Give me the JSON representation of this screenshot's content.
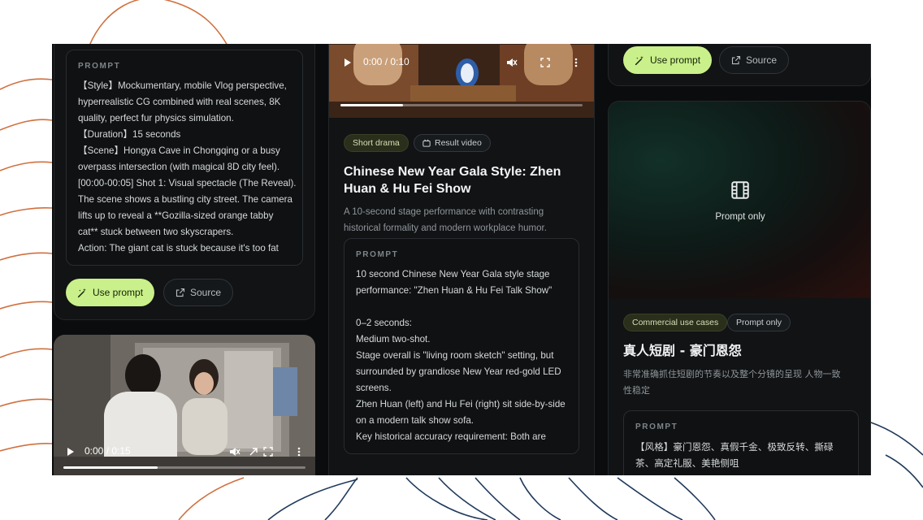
{
  "prompt_label": "PROMPT",
  "left_card": {
    "prompt_lines": [
      "【Style】Mockumentary, mobile Vlog perspective,",
      "hyperrealistic CG combined with real scenes, 8K",
      "quality, perfect fur physics simulation.",
      "【Duration】15 seconds",
      "【Scene】Hongya Cave in Chongqing or a busy",
      "overpass intersection (with magical 8D city feel).",
      "[00:00-00:05] Shot 1: Visual spectacle (The Reveal).",
      "The scene shows a bustling city street. The camera",
      "lifts up to reveal a **Gozilla-sized orange tabby",
      "cat** stuck between two skyscrapers.",
      "Action: The giant cat is stuck because it's too fat"
    ],
    "use_prompt": "Use prompt",
    "source": "Source"
  },
  "left_video": {
    "time": "0:00 / 0:15",
    "progress": 0.39
  },
  "middle_card": {
    "video": {
      "time": "0:00 / 0:10",
      "progress": 0.26
    },
    "tag1": "Short drama",
    "tag2": "Result video",
    "title_line1": "Chinese New Year Gala Style: Zhen",
    "title_line2": "Huan & Hu Fei Show",
    "desc_line1": "A 10-second stage performance with contrasting",
    "desc_line2": "historical formality and modern workplace humor.",
    "prompt_lines": [
      "10 second Chinese New Year Gala style stage",
      "performance: \"Zhen Huan & Hu Fei Talk Show\"",
      "",
      "0–2 seconds:",
      "Medium two-shot.",
      "Stage overall is \"living room sketch\" setting, but",
      "surrounded by grandiose New Year red-gold LED",
      "screens.",
      "Zhen Huan (left) and Hu Fei (right) sit side-by-side",
      "on a modern talk show sofa.",
      " Key historical accuracy requirement: Both are"
    ]
  },
  "right_top": {
    "use_prompt": "Use prompt",
    "source": "Source"
  },
  "right_card": {
    "placeholder": "Prompt only",
    "tag1": "Commercial use cases",
    "tag2": "Prompt only",
    "title": "真人短剧 - 豪门恩怨",
    "desc_line1": "非常准确抓住短剧的节奏以及整个分镜的呈现 人物一致",
    "desc_line2": "性稳定",
    "prompt_lines": [
      "【风格】豪门恩怨、真假千金、极致反转、撕碌",
      "茶、高定礼服、美艳侧咀"
    ]
  }
}
